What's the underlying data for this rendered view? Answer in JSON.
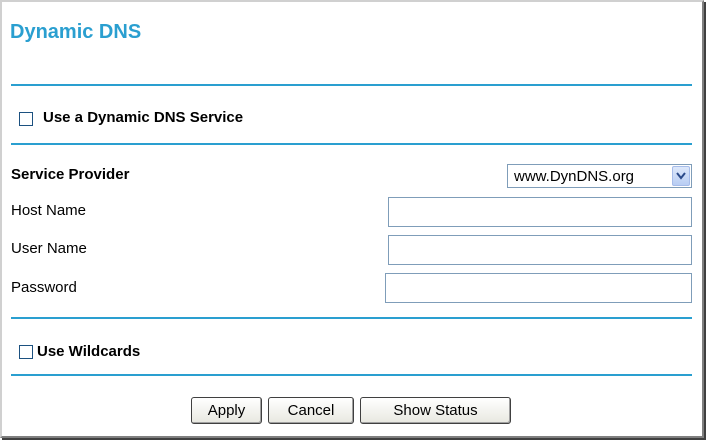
{
  "page": {
    "title": "Dynamic DNS"
  },
  "ddns": {
    "use_service_label": "Use a Dynamic DNS Service",
    "use_service_checked": false
  },
  "provider": {
    "label": "Service Provider",
    "selected": "www.DynDNS.org"
  },
  "fields": {
    "host_name": {
      "label": "Host Name",
      "value": ""
    },
    "user_name": {
      "label": "User Name",
      "value": ""
    },
    "password": {
      "label": "Password",
      "value": ""
    }
  },
  "wildcards": {
    "label": "Use Wildcards",
    "checked": false
  },
  "buttons": {
    "apply": "Apply",
    "cancel": "Cancel",
    "show_status": "Show Status"
  },
  "colors": {
    "accent": "#2a9fd0",
    "field_border": "#7f9db9"
  }
}
